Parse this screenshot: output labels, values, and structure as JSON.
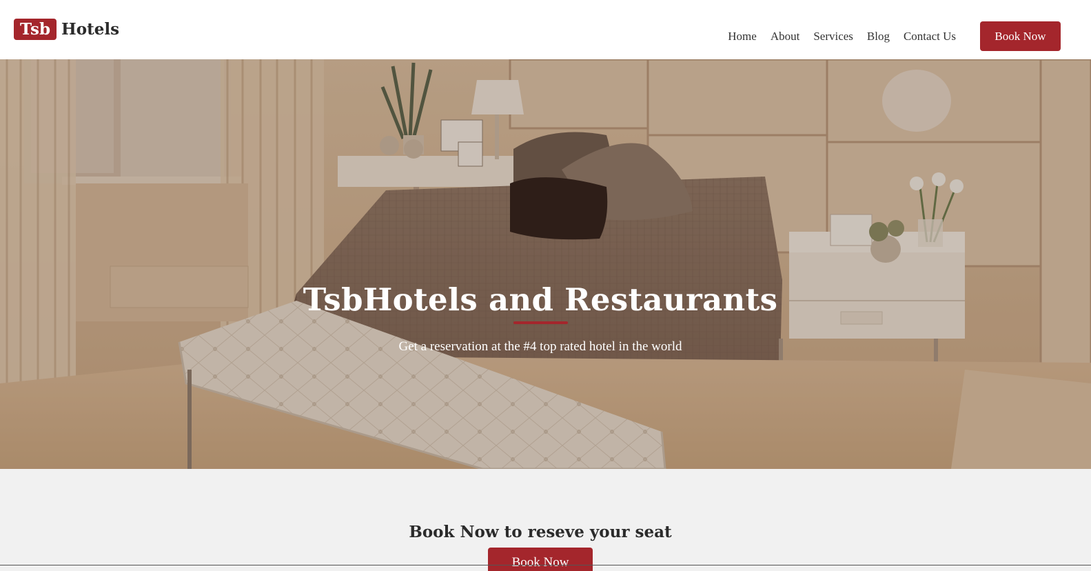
{
  "brand": {
    "badge": "Tsb",
    "name": "Hotels"
  },
  "nav": {
    "items": [
      "Home",
      "About",
      "Services",
      "Blog",
      "Contact Us"
    ],
    "book_label": "Book Now"
  },
  "hero": {
    "title": "TsbHotels and Restaurants",
    "subtitle": "Get a reservation at the #4 top rated hotel in the world",
    "background_icon": "bedroom-photo"
  },
  "cta": {
    "title": "Book Now to reseve your seat",
    "button_label": "Book Now"
  },
  "colors": {
    "accent": "#a4262c",
    "band": "#f1f1f1",
    "text": "#2b2b2b"
  }
}
